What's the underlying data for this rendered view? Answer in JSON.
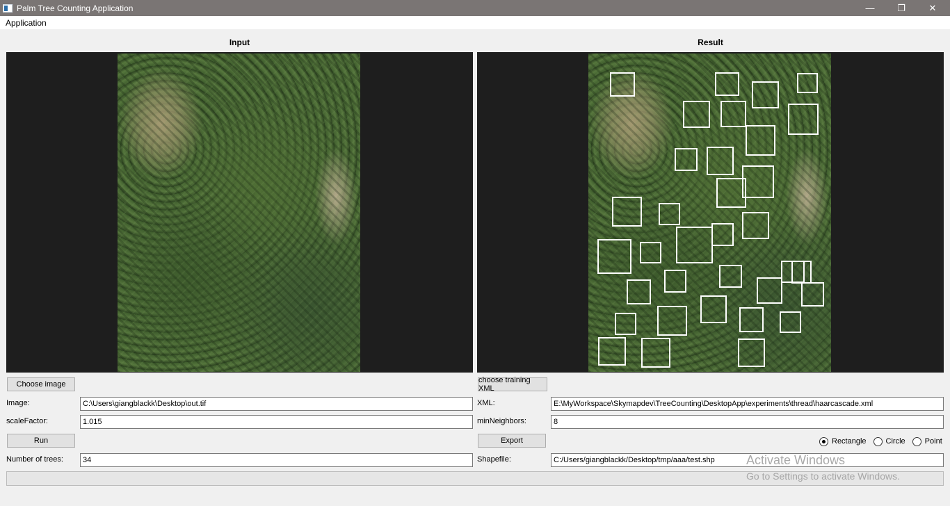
{
  "window": {
    "title": "Palm Tree Counting Application",
    "controls": {
      "minimize": "—",
      "restore": "❐",
      "close": "✕"
    }
  },
  "menu": {
    "items": [
      "Application"
    ]
  },
  "panels": {
    "input_title": "Input",
    "result_title": "Result"
  },
  "left": {
    "choose_image_label": "Choose image",
    "image_label": "Image:",
    "image_value": "C:\\Users\\giangblackk\\Desktop\\out.tif",
    "scale_label": "scaleFactor:",
    "scale_value": "1.015",
    "run_label": "Run",
    "trees_label": "Number of trees:",
    "trees_value": "34"
  },
  "right": {
    "choose_xml_label": "choose training XML",
    "xml_label": "XML:",
    "xml_value": "E:\\MyWorkspace\\Skymapdev\\TreeCounting\\DesktopApp\\experiments\\thread\\haarcascade.xml",
    "minneighbors_label": "minNeighbors:",
    "minneighbors_value": "8",
    "export_label": "Export",
    "shapefile_label": "Shapefile:",
    "shapefile_value": "C:/Users/giangblackk/Desktop/tmp/aaa/test.shp",
    "shape_options": [
      "Rectangle",
      "Circle",
      "Point"
    ],
    "selected_shape": "Rectangle"
  },
  "progress": {
    "value": 0
  },
  "watermark": {
    "line1": "Activate Windows",
    "line2": "Go to Settings to activate Windows."
  }
}
